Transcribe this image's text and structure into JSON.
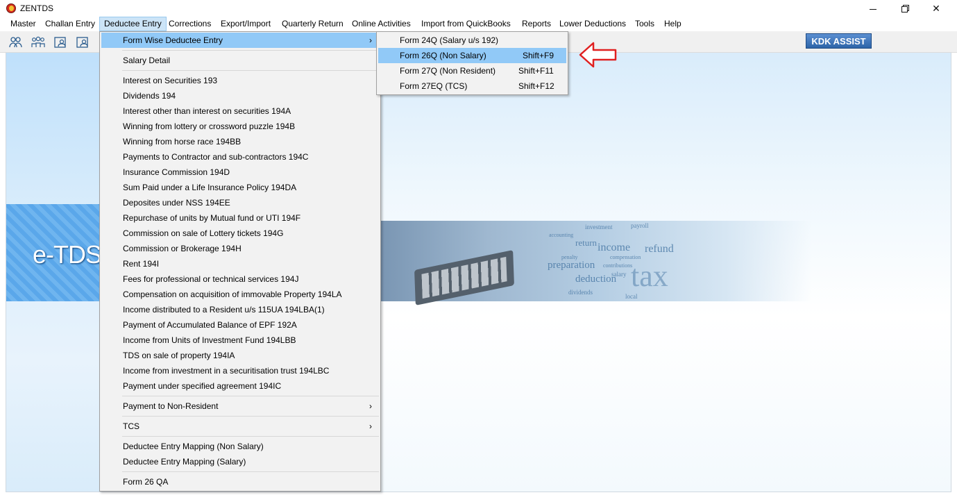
{
  "window": {
    "title": "ZENTDS",
    "controls": [
      "minimize",
      "maximize",
      "close"
    ]
  },
  "menubar": [
    {
      "label": "Master"
    },
    {
      "label": "Challan Entry"
    },
    {
      "label": "Deductee Entry"
    },
    {
      "label": "Corrections"
    },
    {
      "label": "Export/Import"
    },
    {
      "label": "Quarterly Return"
    },
    {
      "label": "Online Activities"
    },
    {
      "label": "Import from QuickBooks"
    },
    {
      "label": "Reports"
    },
    {
      "label": "Lower Deductions"
    },
    {
      "label": "Tools"
    },
    {
      "label": "Help"
    }
  ],
  "toolbar": {
    "icons": [
      "users-icon",
      "group-icon",
      "form-user-icon",
      "form-user-icon-2"
    ],
    "kdk_assist_label": "KDK ASSIST"
  },
  "deductee_menu": {
    "items": [
      {
        "label": "Form Wise Deductee Entry",
        "submenu": true
      },
      {
        "label": "Salary Detail"
      },
      {
        "label": "Interest on Securities 193"
      },
      {
        "label": "Dividends 194"
      },
      {
        "label": "Interest other than interest on securities 194A"
      },
      {
        "label": "Winning from lottery  or crossword puzzle 194B"
      },
      {
        "label": "Winning from horse race 194BB"
      },
      {
        "label": "Payments to Contractor and sub-contractors 194C"
      },
      {
        "label": "Insurance Commission 194D"
      },
      {
        "label": "Sum Paid under a Life Insurance Policy 194DA"
      },
      {
        "label": "Deposites under NSS 194EE"
      },
      {
        "label": "Repurchase of units by Mutual fund or UTI 194F"
      },
      {
        "label": "Commission on sale of Lottery tickets 194G"
      },
      {
        "label": "Commission or Brokerage 194H"
      },
      {
        "label": "Rent 194I"
      },
      {
        "label": "Fees for professional or technical services 194J"
      },
      {
        "label": "Compensation on acquisition of immovable Property 194LA"
      },
      {
        "label": "Income distributed to a Resident u/s 115UA 194LBA(1)"
      },
      {
        "label": "Payment of Accumulated Balance of EPF 192A"
      },
      {
        "label": "Income from Units of Investment Fund 194LBB"
      },
      {
        "label": "TDS on sale of property 194IA"
      },
      {
        "label": "Income from investment in a securitisation trust 194LBC"
      },
      {
        "label": "Payment under specified agreement 194IC"
      },
      {
        "label": "Payment to Non-Resident",
        "submenu": true
      },
      {
        "label": "TCS",
        "submenu": true
      },
      {
        "label": "Deductee Entry Mapping (Non Salary)"
      },
      {
        "label": "Deductee Entry Mapping (Salary)"
      },
      {
        "label": "Form 26 QA"
      }
    ]
  },
  "form_wise_submenu": {
    "items": [
      {
        "label": "Form 24Q (Salary u/s 192)",
        "shortcut": ""
      },
      {
        "label": "Form 26Q (Non Salary)",
        "shortcut": "Shift+F9"
      },
      {
        "label": "Form 27Q (Non Resident)",
        "shortcut": "Shift+F11"
      },
      {
        "label": "Form 27EQ (TCS)",
        "shortcut": "Shift+F12"
      }
    ]
  },
  "background": {
    "banner_text": "e-TDS",
    "wordcloud": [
      "investment",
      "payroll",
      "income",
      "refund",
      "preparation",
      "deduction",
      "tax",
      "return",
      "penalty",
      "compensation",
      "salary",
      "dividends",
      "local",
      "contributions",
      "accounting"
    ]
  },
  "colors": {
    "menu_highlight": "#91c9f7",
    "menubar_active": "#cce4f7",
    "kdk_button": "#2d64a8",
    "annotation_arrow": "#e02020"
  }
}
